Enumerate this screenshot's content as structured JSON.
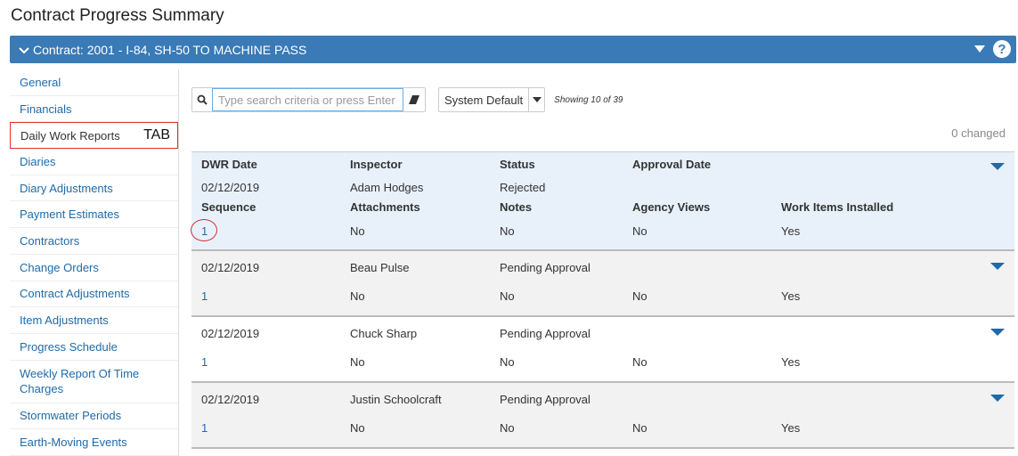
{
  "page_title": "Contract Progress Summary",
  "contract_bar": {
    "title": "Contract: 2001 - I-84, SH-50 TO MACHINE PASS",
    "help": "?"
  },
  "sidebar": {
    "items": [
      {
        "label": "General"
      },
      {
        "label": "Financials"
      },
      {
        "label": "Daily Work Reports",
        "tag": "TAB"
      },
      {
        "label": "Diaries"
      },
      {
        "label": "Diary Adjustments"
      },
      {
        "label": "Payment Estimates"
      },
      {
        "label": "Contractors"
      },
      {
        "label": "Change Orders"
      },
      {
        "label": "Contract Adjustments"
      },
      {
        "label": "Item Adjustments"
      },
      {
        "label": "Progress Schedule"
      },
      {
        "label": "Weekly Report Of Time Charges"
      },
      {
        "label": "Stormwater Periods"
      },
      {
        "label": "Earth-Moving Events"
      }
    ]
  },
  "toolbar": {
    "search_placeholder": "Type search criteria or press Enter",
    "view": "System Default",
    "showing": "Showing 10 of 39",
    "changed": "0 changed"
  },
  "columns": {
    "dwr_date": "DWR Date",
    "inspector": "Inspector",
    "status": "Status",
    "approval_date": "Approval Date",
    "sequence": "Sequence",
    "attachments": "Attachments",
    "notes": "Notes",
    "agency_views": "Agency Views",
    "work_items": "Work Items Installed"
  },
  "rows": [
    {
      "date": "02/12/2019",
      "inspector": "Adam Hodges",
      "status": "Rejected",
      "approval": "",
      "sequence": "1",
      "attachments": "No",
      "notes": "No",
      "agency": "No",
      "work": "Yes"
    },
    {
      "date": "02/12/2019",
      "inspector": "Beau Pulse",
      "status": "Pending Approval",
      "approval": "",
      "sequence": "1",
      "attachments": "No",
      "notes": "No",
      "agency": "No",
      "work": "Yes"
    },
    {
      "date": "02/12/2019",
      "inspector": "Chuck Sharp",
      "status": "Pending Approval",
      "approval": "",
      "sequence": "1",
      "attachments": "No",
      "notes": "No",
      "agency": "No",
      "work": "Yes"
    },
    {
      "date": "02/12/2019",
      "inspector": "Justin Schoolcraft",
      "status": "Pending Approval",
      "approval": "",
      "sequence": "1",
      "attachments": "No",
      "notes": "No",
      "agency": "No",
      "work": "Yes"
    }
  ],
  "colors": {
    "accent": "#3a7ab6",
    "link": "#1f6aa8",
    "highlight": "#e03030"
  }
}
